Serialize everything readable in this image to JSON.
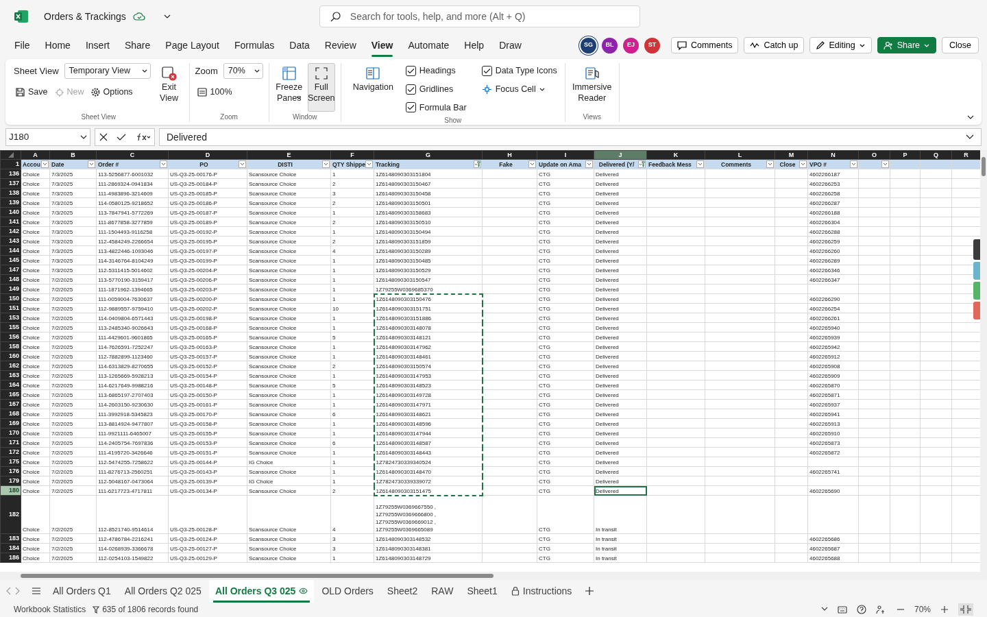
{
  "title_bar": {
    "document_title": "Orders & Trackings",
    "search": {
      "placeholder": "Search for tools, help, and more (Alt + Q)"
    }
  },
  "menu_tabs": [
    {
      "label": "File",
      "selected": false
    },
    {
      "label": "Home",
      "selected": false
    },
    {
      "label": "Insert",
      "selected": false
    },
    {
      "label": "Share",
      "selected": false
    },
    {
      "label": "Page Layout",
      "selected": false
    },
    {
      "label": "Formulas",
      "selected": false
    },
    {
      "label": "Data",
      "selected": false
    },
    {
      "label": "Review",
      "selected": false
    },
    {
      "label": "View",
      "selected": true
    },
    {
      "label": "Automate",
      "selected": false
    },
    {
      "label": "Help",
      "selected": false
    },
    {
      "label": "Draw",
      "selected": false
    }
  ],
  "collaborators": [
    {
      "initials": "SG",
      "color": "#1e3f73"
    },
    {
      "initials": "BL",
      "color": "#8e24aa"
    },
    {
      "initials": "EJ",
      "color": "#d0208f"
    },
    {
      "initials": "ST",
      "color": "#d13438"
    }
  ],
  "header_buttons": [
    {
      "label": "Comments",
      "kind": "comments"
    },
    {
      "label": "Catch up",
      "kind": "catchup"
    },
    {
      "label": "Editing",
      "kind": "editing"
    },
    {
      "label": "Share",
      "kind": "share"
    },
    {
      "label": "Close",
      "kind": "close"
    }
  ],
  "ribbon": {
    "sheet_view": {
      "label": "Sheet View",
      "view_select": "Temporary View",
      "save": "Save",
      "new": {
        "label": "New",
        "disabled": true
      },
      "options": "Options",
      "exit_view": "Exit View",
      "group_label": "Sheet View"
    },
    "zoom": {
      "label": "Zoom",
      "value": "70%",
      "reset": "100%",
      "group_label": "Zoom"
    },
    "window": {
      "freeze_panes": "Freeze Panes",
      "full_screen": {
        "label": "Full Screen",
        "pressed": true
      },
      "group_label": "Window"
    },
    "show": {
      "navigation": "Navigation",
      "checkboxes": [
        {
          "label": "Headings",
          "checked": true
        },
        {
          "label": "Gridlines",
          "checked": true
        },
        {
          "label": "Formula Bar",
          "checked": true
        },
        {
          "label": "Data Type Icons",
          "checked": true
        }
      ],
      "focus_cell": "Focus Cell",
      "group_label": "Show"
    },
    "views": {
      "immersive_reader": "Immersive Reader",
      "group_label": "Views"
    }
  },
  "formula_bar": {
    "name_box": "J180",
    "formula": "Delivered"
  },
  "grid": {
    "columns": [
      {
        "letter": "A",
        "selected": false
      },
      {
        "letter": "B",
        "selected": false
      },
      {
        "letter": "C",
        "selected": false
      },
      {
        "letter": "D",
        "selected": false
      },
      {
        "letter": "E",
        "selected": false
      },
      {
        "letter": "F",
        "selected": false
      },
      {
        "letter": "G",
        "selected": false
      },
      {
        "letter": "H",
        "selected": false
      },
      {
        "letter": "I",
        "selected": false
      },
      {
        "letter": "J",
        "selected": true
      },
      {
        "letter": "K",
        "selected": false
      },
      {
        "letter": "L",
        "selected": false
      },
      {
        "letter": "M",
        "selected": false
      },
      {
        "letter": "N",
        "selected": false
      },
      {
        "letter": "O",
        "selected": false
      },
      {
        "letter": "P",
        "selected": false
      },
      {
        "letter": "Q",
        "selected": false
      },
      {
        "letter": "R",
        "selected": false
      }
    ],
    "header_row": {
      "number": "1",
      "headers": [
        {
          "label": "Accou",
          "filtered": false
        },
        {
          "label": "Date",
          "filtered": false
        },
        {
          "label": "Order #",
          "filtered": false
        },
        {
          "label": "PO",
          "filtered": false
        },
        {
          "label": "DISTI",
          "filtered": false
        },
        {
          "label": "QTY Shippe",
          "filtered": false
        },
        {
          "label": "Tracking",
          "filtered": true
        },
        {
          "label": "Fake",
          "filtered": false
        },
        {
          "label": "Update on Ama",
          "filtered": false
        },
        {
          "label": "Delivered (Y/",
          "filtered": true
        },
        {
          "label": "Feedback Mess",
          "filtered": false
        },
        {
          "label": "Comments",
          "filtered": false
        },
        {
          "label": "Close",
          "filtered": false
        },
        {
          "label": "VPO #",
          "filtered": false
        },
        {
          "filtered": false
        }
      ]
    },
    "rows": [
      {
        "number": "136",
        "selected": false,
        "copied": false,
        "account": "Choice",
        "date": "7/3/2025",
        "order": "113-5256877-6001032",
        "po": "US-Q3-25-00176-P",
        "disti": "Scansource Choice",
        "qty": "1",
        "tracking": "1Z6148090303151804",
        "update": "CTG",
        "delivered": "Delivered",
        "vpo": "4602266187"
      },
      {
        "number": "137",
        "selected": false,
        "copied": false,
        "account": "Choice",
        "date": "7/3/2025",
        "order": "111-2869324-0941834",
        "po": "US-Q3-25-00184-P",
        "disti": "Scansource Choice",
        "qty": "2",
        "tracking": "1Z6148090303150467",
        "update": "CTG",
        "delivered": "Delivered",
        "vpo": "4602266253"
      },
      {
        "number": "138",
        "selected": false,
        "copied": false,
        "account": "Choice",
        "date": "7/3/2025",
        "order": "111-4983896-3214609",
        "po": "US-Q3-25-00185-P",
        "disti": "Scansource Choice",
        "qty": "3",
        "tracking": "1Z6148090303150458",
        "update": "CTG",
        "delivered": "Delivered",
        "vpo": "4602266258"
      },
      {
        "number": "139",
        "selected": false,
        "copied": false,
        "account": "Choice",
        "date": "7/3/2025",
        "order": "114-0580125-9218652",
        "po": "US-Q3-25-00186-P",
        "disti": "Scansource Choice",
        "qty": "2",
        "tracking": "1Z6148090303150501",
        "update": "CTG",
        "delivered": "Delivered",
        "vpo": "4602266287"
      },
      {
        "number": "140",
        "selected": false,
        "copied": false,
        "account": "Choice",
        "date": "7/3/2025",
        "order": "113-7847941-5772269",
        "po": "US-Q3-25-00187-P",
        "disti": "Scansource Choice",
        "qty": "1",
        "tracking": "1Z6148090303158683",
        "update": "CTG",
        "delivered": "Delivered",
        "vpo": "4602266188"
      },
      {
        "number": "141",
        "selected": false,
        "copied": false,
        "account": "Choice",
        "date": "7/3/2025",
        "order": "111-8677858-3277859",
        "po": "US-Q3-25-00189-P",
        "disti": "Scansource Choice",
        "qty": "2",
        "tracking": "1Z6148090303150510",
        "update": "CTG",
        "delivered": "Delivered",
        "vpo": "4602266304"
      },
      {
        "number": "142",
        "selected": false,
        "copied": false,
        "account": "Choice",
        "date": "7/3/2025",
        "order": "111-1504493-9116258",
        "po": "US-Q3-25-00192-P",
        "disti": "Scansource Choice",
        "qty": "1",
        "tracking": "1Z6148090303150494",
        "update": "CTG",
        "delivered": "Delivered",
        "vpo": "4602266288"
      },
      {
        "number": "143",
        "selected": false,
        "copied": false,
        "account": "Choice",
        "date": "7/3/2025",
        "order": "112-4584249-2266654",
        "po": "US-Q3-25-00195-P",
        "disti": "Scansource Choice",
        "qty": "2",
        "tracking": "1Z6148090303151859",
        "update": "CTG",
        "delivered": "Delivered",
        "vpo": "4602266259"
      },
      {
        "number": "144",
        "selected": false,
        "copied": false,
        "account": "Choice",
        "date": "7/3/2025",
        "order": "113-4822446-1093046",
        "po": "US-Q3-25-00197-P",
        "disti": "Scansource Choice",
        "qty": "4",
        "tracking": "1Z6148090303150289",
        "update": "CTG",
        "delivered": "Delivered",
        "vpo": "4602266260"
      },
      {
        "number": "145",
        "selected": false,
        "copied": false,
        "account": "Choice",
        "date": "7/3/2025",
        "order": "114-3146764-8104249",
        "po": "US-Q3-25-00199-P",
        "disti": "Scansource Choice",
        "qty": "1",
        "tracking": "1Z6148090303150485",
        "update": "CTG",
        "delivered": "Delivered",
        "vpo": "4602266289"
      },
      {
        "number": "147",
        "selected": false,
        "copied": false,
        "account": "Choice",
        "date": "7/3/2025",
        "order": "112-5311415-5014602",
        "po": "US-Q3-25-00204-P",
        "disti": "Scansource Choice",
        "qty": "1",
        "tracking": "1Z6148090303150529",
        "update": "CTG",
        "delivered": "Delivered",
        "vpo": "4602266346"
      },
      {
        "number": "148",
        "selected": false,
        "copied": false,
        "account": "Choice",
        "date": "7/2/2025",
        "order": "113-5770190-3159417",
        "po": "US-Q3-25-00206-P",
        "disti": "Scansource Choice",
        "qty": "1",
        "tracking": "1Z6148090303150547",
        "update": "CTG",
        "delivered": "Delivered",
        "vpo": "4602266347"
      },
      {
        "number": "149",
        "selected": false,
        "copied": false,
        "account": "Choice",
        "date": "7/2/2025",
        "order": "111-1871962-1394665",
        "po": "US-Q3-25-00203-P",
        "disti": "Scansource Choice",
        "qty": "1",
        "tracking": "1Z79255W0369685370",
        "update": "CTG",
        "delivered": "Delivered"
      },
      {
        "number": "150",
        "selected": false,
        "copied": true,
        "account": "Choice",
        "date": "7/2/2025",
        "order": "111-0059004-7630637",
        "po": "US-Q3-25-00200-P",
        "disti": "Scansource Choice",
        "qty": "1",
        "tracking": "1Z6148090303150476",
        "update": "CTG",
        "delivered": "Delivered",
        "vpo": "4602266290"
      },
      {
        "number": "151",
        "selected": false,
        "copied": true,
        "account": "Choice",
        "date": "7/2/2025",
        "order": "112-9889557-9759410",
        "po": "US-Q3-25-00202-P",
        "disti": "Scansource Choice",
        "qty": "10",
        "tracking": "1Z6148090303151751",
        "update": "CTG",
        "delivered": "Delivered",
        "vpo": "4602266254"
      },
      {
        "number": "153",
        "selected": false,
        "copied": true,
        "account": "Choice",
        "date": "7/2/2025",
        "order": "114-0409804-6571443",
        "po": "US-Q3-25-00198-P",
        "disti": "Scansource Choice",
        "qty": "1",
        "tracking": "1Z6148090303151886",
        "update": "CTG",
        "delivered": "Delivered",
        "vpo": "4602266261"
      },
      {
        "number": "155",
        "selected": false,
        "copied": true,
        "account": "Choice",
        "date": "7/2/2025",
        "order": "113-2485340-9026643",
        "po": "US-Q3-25-00168-P",
        "disti": "Scansource Choice",
        "qty": "1",
        "tracking": "1Z6148090303148078",
        "update": "CTG",
        "delivered": "Delivered",
        "vpo": "4602265940"
      },
      {
        "number": "156",
        "selected": false,
        "copied": true,
        "account": "Choice",
        "date": "7/2/2025",
        "order": "111-4429601-9601865",
        "po": "US-Q3-25-00165-P",
        "disti": "Scansource Choice",
        "qty": "5",
        "tracking": "1Z6148090303148121",
        "update": "CTG",
        "delivered": "Delivered",
        "vpo": "4602265939"
      },
      {
        "number": "158",
        "selected": false,
        "copied": true,
        "account": "Choice",
        "date": "7/2/2025",
        "order": "114-7626591-7252247",
        "po": "US-Q3-25-00163-P",
        "disti": "Scansource Choice",
        "qty": "1",
        "tracking": "1Z6148090303147962",
        "update": "CTG",
        "delivered": "Delivered",
        "vpo": "4602265942"
      },
      {
        "number": "160",
        "selected": false,
        "copied": true,
        "account": "Choice",
        "date": "7/2/2025",
        "order": "112-7882899-1123460",
        "po": "US-Q3-25-00157-P",
        "disti": "Scansource Choice",
        "qty": "1",
        "tracking": "1Z6148090303148461",
        "update": "CTG",
        "delivered": "Delivered",
        "vpo": "4602265912"
      },
      {
        "number": "162",
        "selected": false,
        "copied": true,
        "account": "Choice",
        "date": "7/2/2025",
        "order": "114-6313829-8270655",
        "po": "US-Q3-25-00152-P",
        "disti": "Scansource Choice",
        "qty": "2",
        "tracking": "1Z6148090303150574",
        "update": "CTG",
        "delivered": "Delivered",
        "vpo": "4602265908"
      },
      {
        "number": "163",
        "selected": false,
        "copied": true,
        "account": "Choice",
        "date": "7/2/2025",
        "order": "113-1265669-5928213",
        "po": "US-Q3-25-00154-P",
        "disti": "Scansource Choice",
        "qty": "1",
        "tracking": "1Z6148090303147953",
        "update": "CTG",
        "delivered": "Delivered",
        "vpo": "4602265909"
      },
      {
        "number": "164",
        "selected": false,
        "copied": true,
        "account": "Choice",
        "date": "7/2/2025",
        "order": "114-6217649-9988216",
        "po": "US-Q3-25-00148-P",
        "disti": "Scansource Choice",
        "qty": "5",
        "tracking": "1Z6148090303148523",
        "update": "CTG",
        "delivered": "Delivered",
        "vpo": "4602265870"
      },
      {
        "number": "165",
        "selected": false,
        "copied": true,
        "account": "Choice",
        "date": "7/2/2025",
        "order": "113-6865197-2707403",
        "po": "US-Q3-25-00150-P",
        "disti": "Scansource Choice",
        "qty": "1",
        "tracking": "1Z6148090303149728",
        "update": "CTG",
        "delivered": "Delivered",
        "vpo": "4602265871"
      },
      {
        "number": "167",
        "selected": false,
        "copied": true,
        "account": "Choice",
        "date": "7/2/2025",
        "order": "114-2603150-9230630",
        "po": "US-Q3-25-00161-P",
        "disti": "Scansource Choice",
        "qty": "1",
        "tracking": "1Z6148090303147971",
        "update": "CTG",
        "delivered": "Delivered",
        "vpo": "4602265937"
      },
      {
        "number": "168",
        "selected": false,
        "copied": true,
        "account": "Choice",
        "date": "7/2/2025",
        "order": "111-3992918-5345823",
        "po": "US-Q3-25-00170-P",
        "disti": "Scansource Choice",
        "qty": "6",
        "tracking": "1Z6148090303148621",
        "update": "CTG",
        "delivered": "Delivered",
        "vpo": "4602265941"
      },
      {
        "number": "169",
        "selected": false,
        "copied": true,
        "account": "Choice",
        "date": "7/2/2025",
        "order": "113-8814924-9477807",
        "po": "US-Q3-25-00158-P",
        "disti": "Scansource Choice",
        "qty": "1",
        "tracking": "1Z6148090303148596",
        "update": "CTG",
        "delivered": "Delivered",
        "vpo": "4602265913"
      },
      {
        "number": "170",
        "selected": false,
        "copied": true,
        "account": "Choice",
        "date": "7/2/2025",
        "order": "111-9921111-6465007",
        "po": "US-Q3-25-00155-P",
        "disti": "Scansource Choice",
        "qty": "1",
        "tracking": "1Z6148090303147944",
        "update": "CTG",
        "delivered": "Delivered",
        "vpo": "4602265910"
      },
      {
        "number": "171",
        "selected": false,
        "copied": true,
        "account": "Choice",
        "date": "7/2/2025",
        "order": "114-2405754-7697836",
        "po": "US-Q3-25-00153-P",
        "disti": "Scansource Choice",
        "qty": "6",
        "tracking": "1Z6148090303148587",
        "update": "CTG",
        "delivered": "Delivered",
        "vpo": "4602265873"
      },
      {
        "number": "172",
        "selected": false,
        "copied": true,
        "account": "Choice",
        "date": "7/2/2025",
        "order": "111-4195720-3426646",
        "po": "US-Q3-25-00151-P",
        "disti": "Scansource Choice",
        "qty": "1",
        "tracking": "1Z6148090303148443",
        "update": "CTG",
        "delivered": "Delivered",
        "vpo": "4602265872"
      },
      {
        "number": "175",
        "selected": false,
        "copied": true,
        "account": "Choice",
        "date": "7/2/2025",
        "order": "112-5474255-7258622",
        "po": "US-Q3-25-00144-P",
        "disti": "IG Choice",
        "qty": "1",
        "tracking": "1Z7824730339340524",
        "update": "CTG",
        "delivered": "Delivered"
      },
      {
        "number": "176",
        "selected": false,
        "copied": true,
        "account": "Choice",
        "date": "7/2/2025",
        "order": "111-8276713-2560251",
        "po": "US-Q3-25-00143-P",
        "disti": "Scansource Choice",
        "qty": "1",
        "tracking": "1Z6148090303148470",
        "update": "CTG",
        "delivered": "Delivered",
        "vpo": "4602265741"
      },
      {
        "number": "179",
        "selected": false,
        "copied": true,
        "account": "Choice",
        "date": "7/2/2025",
        "order": "112-5048167-0473064",
        "po": "US-Q3-25-00139-P",
        "disti": "IG Choice",
        "qty": "1",
        "tracking": "1Z7824730339339072",
        "update": "CTG",
        "delivered": "Delivered"
      },
      {
        "number": "180",
        "selected": true,
        "copied": true,
        "account": "Choice",
        "date": "7/2/2025",
        "order": "111-6217723-4717811",
        "po": "US-Q3-25-00134-P",
        "disti": "Scansource Choice",
        "qty": "2",
        "tracking": "1Z6148090303151475",
        "update": "CTG",
        "delivered": "Delivered",
        "vpo": "4602265690"
      },
      {
        "number": "182",
        "selected": false,
        "copied": false,
        "account": "Choice",
        "date": "7/2/2025",
        "order": "112-8521740-9514614",
        "po": "US-Q3-25-00128-P",
        "disti": "Scansource Choice",
        "qty": "4",
        "tracking": "1Z79255W0369667550 ,\n1Z79255W0369666800 ,\n1Z79255W0369669012 ,\n1Z79255W0369665089",
        "update": "CTG",
        "delivered": "In transit"
      },
      {
        "number": "183",
        "selected": false,
        "copied": false,
        "account": "Choice",
        "date": "7/2/2025",
        "order": "112-4786784-2216241",
        "po": "US-Q3-25-00124-P",
        "disti": "Scansource Choice",
        "qty": "3",
        "tracking": "1Z6148090303148532",
        "update": "CTG",
        "delivered": "In transit",
        "vpo": "4602265686"
      },
      {
        "number": "184",
        "selected": false,
        "copied": false,
        "account": "Choice",
        "date": "7/2/2025",
        "order": "114-0268939-3366678",
        "po": "US-Q3-25-00127-P",
        "disti": "Scansource Choice",
        "qty": "3",
        "tracking": "1Z6148090303148381",
        "update": "CTG",
        "delivered": "In transit",
        "vpo": "4602265687"
      },
      {
        "number": "186",
        "selected": false,
        "copied": false,
        "account": "Choice",
        "date": "7/2/2025",
        "order": "112-0254103-1549822",
        "po": "US-Q3-25-00129-P",
        "disti": "Scansource Choice",
        "qty": "1",
        "tracking": "1Z6148090303148729",
        "update": "CTG",
        "delivered": "In transit",
        "vpo": "4602265688"
      }
    ]
  },
  "sheet_tabs": [
    {
      "label": "All Orders Q1",
      "selected": false,
      "kind": "plain"
    },
    {
      "label": "All Orders Q2 025",
      "selected": false,
      "kind": "plain"
    },
    {
      "label": "All Orders Q3 025",
      "selected": true,
      "kind": "view"
    },
    {
      "label": "OLD Orders",
      "selected": false,
      "kind": "plain"
    },
    {
      "label": "Sheet2",
      "selected": false,
      "kind": "plain"
    },
    {
      "label": "RAW",
      "selected": false,
      "kind": "plain"
    },
    {
      "label": "Sheet1",
      "selected": false,
      "kind": "plain"
    },
    {
      "label": "Instructions",
      "selected": false,
      "kind": "locked"
    }
  ],
  "status_bar": {
    "workbook_statistics": "Workbook Statistics",
    "filter_status": "635 of 1806 records found",
    "zoom": "70%"
  }
}
